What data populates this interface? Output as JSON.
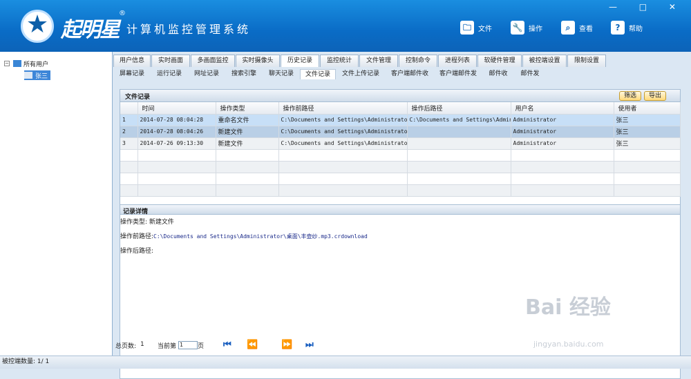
{
  "app": {
    "brand": "起明星",
    "brand_mark": "®",
    "title": "计算机监控管理系统"
  },
  "header_buttons": [
    {
      "label": "文件",
      "icon": "folder-icon",
      "glyph": "🗀"
    },
    {
      "label": "操作",
      "icon": "wrench-icon",
      "glyph": "🔧"
    },
    {
      "label": "查看",
      "icon": "search-icon",
      "glyph": "⌕"
    },
    {
      "label": "帮助",
      "icon": "help-icon",
      "glyph": "?"
    }
  ],
  "window_controls": "— □ ✕",
  "tree": {
    "root": "所有用户",
    "child": "张三"
  },
  "tabs_top": [
    "用户信息",
    "实时画面",
    "多画面监控",
    "实时摄像头",
    "历史记录",
    "监控统计",
    "文件管理",
    "控制命令",
    "进程列表",
    "软硬件管理",
    "被控端设置",
    "限制设置"
  ],
  "tabs_top_active": 4,
  "tabs_sub": [
    "屏幕记录",
    "运行记录",
    "网址记录",
    "搜索引擎",
    "聊天记录",
    "文件记录",
    "文件上传记录",
    "客户端邮件收",
    "客户端邮件发",
    "邮件收",
    "邮件发"
  ],
  "tabs_sub_active": 5,
  "panel": {
    "title": "文件记录",
    "filter_label": "筛选",
    "export_label": "导出"
  },
  "table": {
    "columns": [
      "时间",
      "操作类型",
      "操作前路径",
      "操作后路径",
      "用户名",
      "使用者"
    ],
    "rows": [
      {
        "n": "1",
        "time": "2014-07-28 08:04:28",
        "type": "重命名文件",
        "before": "C:\\Documents and Settings\\Administrator\\桌",
        "after": "C:\\Documents and Settings\\Adminis",
        "user": "Administrator",
        "owner": "张三"
      },
      {
        "n": "2",
        "time": "2014-07-28 08:04:26",
        "type": "新建文件",
        "before": "C:\\Documents and Settings\\Administrator\\桌",
        "after": "",
        "user": "Administrator",
        "owner": "张三"
      },
      {
        "n": "3",
        "time": "2014-07-26 09:13:30",
        "type": "新建文件",
        "before": "C:\\Documents and Settings\\Administrator\\桌",
        "after": "",
        "user": "Administrator",
        "owner": "张三"
      }
    ]
  },
  "detail": {
    "title": "记录详情",
    "type_label": "操作类型:",
    "type_value": "新建文件",
    "before_label": "操作前路径:",
    "before_value": "C:\\Documents and Settings\\Administrator\\桌面\\丰壶纱.mp3.crdownload",
    "after_label": "操作后路径:"
  },
  "pager": {
    "total_label": "总页数:",
    "total": "1",
    "current_label": "当前第",
    "current": "1",
    "page_suffix": "页",
    "nav": [
      "⏮",
      "⏪",
      "⏩",
      "⏭"
    ]
  },
  "status": {
    "label": "被控端数量:",
    "value": "1/ 1"
  },
  "watermark": {
    "text": "Bai 经验",
    "url": "jingyan.baidu.com"
  }
}
